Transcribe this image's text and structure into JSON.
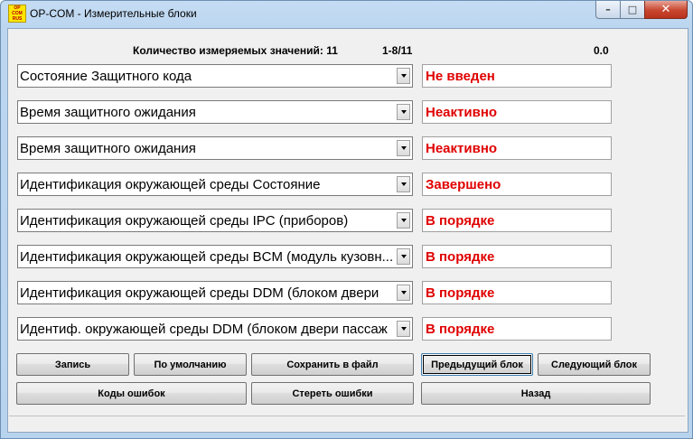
{
  "window": {
    "title": "OP-COM - Измерительные блоки",
    "icon_text": [
      "OP",
      "COM",
      "RUS"
    ],
    "minimize_glyph": "–",
    "maximize_glyph": "□",
    "close_glyph": "✕"
  },
  "header": {
    "count_label": "Количество измеряемых значений: 11",
    "range_label": "1-8/11",
    "time_label": "0.0"
  },
  "rows": [
    {
      "name": "Состояние Защитного кода",
      "value": "Не введен"
    },
    {
      "name": "Время защитного ожидания",
      "value": "Неактивно"
    },
    {
      "name": "Время защитного ожидания",
      "value": "Неактивно"
    },
    {
      "name": "Идентификация окружающей среды Состояние",
      "value": "Завершено"
    },
    {
      "name": "Идентификация окружающей среды IPC (приборов)",
      "value": "В порядке"
    },
    {
      "name": "Идентификация окружающей среды BCM (модуль кузовн...",
      "value": "В порядке"
    },
    {
      "name": "Идентификация окружающей среды DDM (блоком двери",
      "value": "В порядке"
    },
    {
      "name": "Идентиф. окружающей среды DDM (блоком двери пассаж",
      "value": "В порядке"
    }
  ],
  "buttons": {
    "record": "Запись",
    "default": "По умолчанию",
    "save_file": "Сохранить в файл",
    "prev_block": "Предыдущий блок",
    "next_block": "Следующий блок",
    "error_codes": "Коды ошибок",
    "clear_errors": "Стереть ошибки",
    "back": "Назад"
  },
  "colors": {
    "value_text": "#e00000"
  }
}
